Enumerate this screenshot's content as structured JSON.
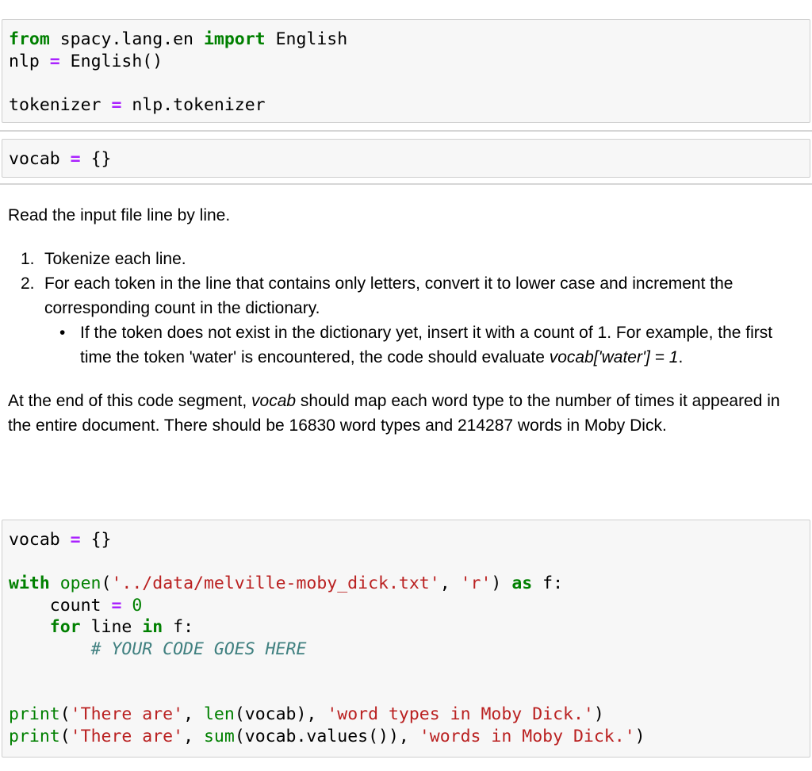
{
  "cell1": {
    "kw_from": "from",
    "module": " spacy.lang.en ",
    "kw_import": "import",
    "cls": " English",
    "l2_var": "nlp ",
    "l2_op": "=",
    "l2_rhs": " English()",
    "l4_var": "tokenizer ",
    "l4_op": "=",
    "l4_rhs": " nlp.tokenizer"
  },
  "cell2": {
    "var": "vocab ",
    "op": "=",
    "rhs": " {}"
  },
  "markdown": {
    "intro": "Read the input file line by line.",
    "step1_num": "1.",
    "step1": "Tokenize each line.",
    "step2_num": "2.",
    "step2": "For each token in the line that contains only letters, convert it to lower case and increment the corresponding count in the dictionary.",
    "bullet": "•",
    "sub_a": "If the token does not exist in the dictionary yet, insert it with a count of 1. For example, the first time the token 'water' is encountered, the code should evaluate ",
    "sub_em": "vocab['water'] = 1",
    "sub_b": ".",
    "outro_a": "At the end of this code segment, ",
    "outro_em": "vocab",
    "outro_b": " should map each word type to the number of times it appeared in the entire document. There should be 16830 word types and 214287 words in Moby Dick."
  },
  "cell3": {
    "l1_var": "vocab ",
    "l1_op": "=",
    "l1_rhs": " {}",
    "l3_with": "with",
    "l3_open": " open",
    "l3_p1": "(",
    "l3_s1": "'../data/melville-moby_dick.txt'",
    "l3_comma": ", ",
    "l3_s2": "'r'",
    "l3_p2": ") ",
    "l3_as": "as",
    "l3_f": " f:",
    "l4_var": "    count ",
    "l4_op": "=",
    "l4_val": " 0",
    "l5_indent": "    ",
    "l5_for": "for",
    "l5_mid": " line ",
    "l5_in": "in",
    "l5_end": " f:",
    "l6_indent": "        ",
    "l6_comment": "# YOUR CODE GOES HERE",
    "l9_print": "print",
    "l9_p1": "(",
    "l9_s1": "'There are'",
    "l9_c1": ", ",
    "l9_len": "len",
    "l9_arg": "(vocab), ",
    "l9_s2": "'word types in Moby Dick.'",
    "l9_end": ")",
    "l10_print": "print",
    "l10_p1": "(",
    "l10_s1": "'There are'",
    "l10_c1": ", ",
    "l10_sum": "sum",
    "l10_arg": "(vocab.values()), ",
    "l10_s2": "'words in Moby Dick.'",
    "l10_end": ")"
  }
}
